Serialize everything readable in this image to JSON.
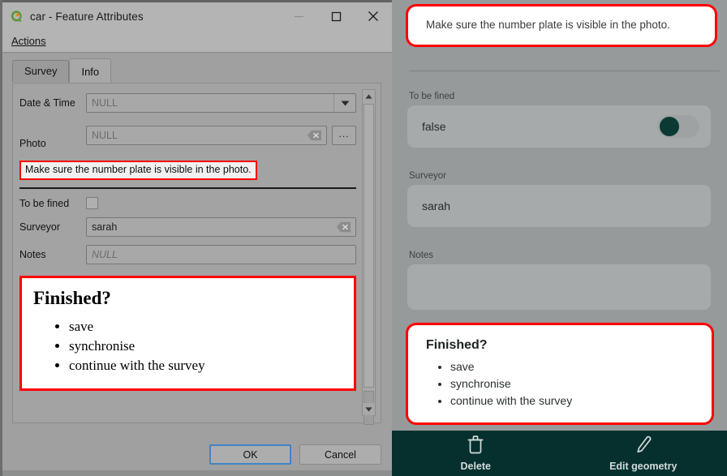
{
  "desktop": {
    "title": "car - Feature Attributes",
    "logo_icon": "qgis-logo-icon",
    "window_controls": {
      "minimize": "minimize-icon",
      "maximize": "maximize-icon",
      "close": "close-icon"
    },
    "menu": [
      {
        "label": "Actions",
        "accel": "A"
      }
    ],
    "tabs": [
      {
        "label": "Survey",
        "active": false
      },
      {
        "label": "Info",
        "active": true
      }
    ],
    "form": {
      "date_time": {
        "label": "Date & Time",
        "value": "NULL",
        "is_null": true
      },
      "photo": {
        "label": "Photo",
        "value": "NULL",
        "is_null": true,
        "browse_label": "...",
        "clear_icon": "clear-icon"
      },
      "hint": "Make sure the number plate is visible in the photo.",
      "to_be_fined": {
        "label": "To be fined",
        "checked": false
      },
      "surveyor": {
        "label": "Surveyor",
        "value": "sarah",
        "clear_icon": "clear-icon"
      },
      "notes": {
        "label": "Notes",
        "value": "NULL",
        "is_null": true
      }
    },
    "finished": {
      "title": "Finished?",
      "items": [
        "save",
        "synchronise",
        "continue with the survey"
      ]
    },
    "buttons": {
      "ok": "OK",
      "cancel": "Cancel"
    }
  },
  "mobile": {
    "hint": "Make sure the number plate is visible in the photo.",
    "fields": {
      "to_be_fined": {
        "label": "To be fined",
        "value": "false",
        "toggle_on": false
      },
      "surveyor": {
        "label": "Surveyor",
        "value": "sarah"
      },
      "notes": {
        "label": "Notes",
        "value": ""
      }
    },
    "finished": {
      "title": "Finished?",
      "items": [
        "save",
        "synchronise",
        "continue with the survey"
      ]
    },
    "bottom_bar": [
      {
        "label": "Delete",
        "icon": "trash-icon"
      },
      {
        "label": "Edit geometry",
        "icon": "pencil-icon"
      }
    ]
  },
  "colors": {
    "highlight": "#ff0000",
    "accent_dark": "#05302e",
    "toggle_knob": "#0b3a34",
    "default_button_border": "#3f85c6"
  }
}
